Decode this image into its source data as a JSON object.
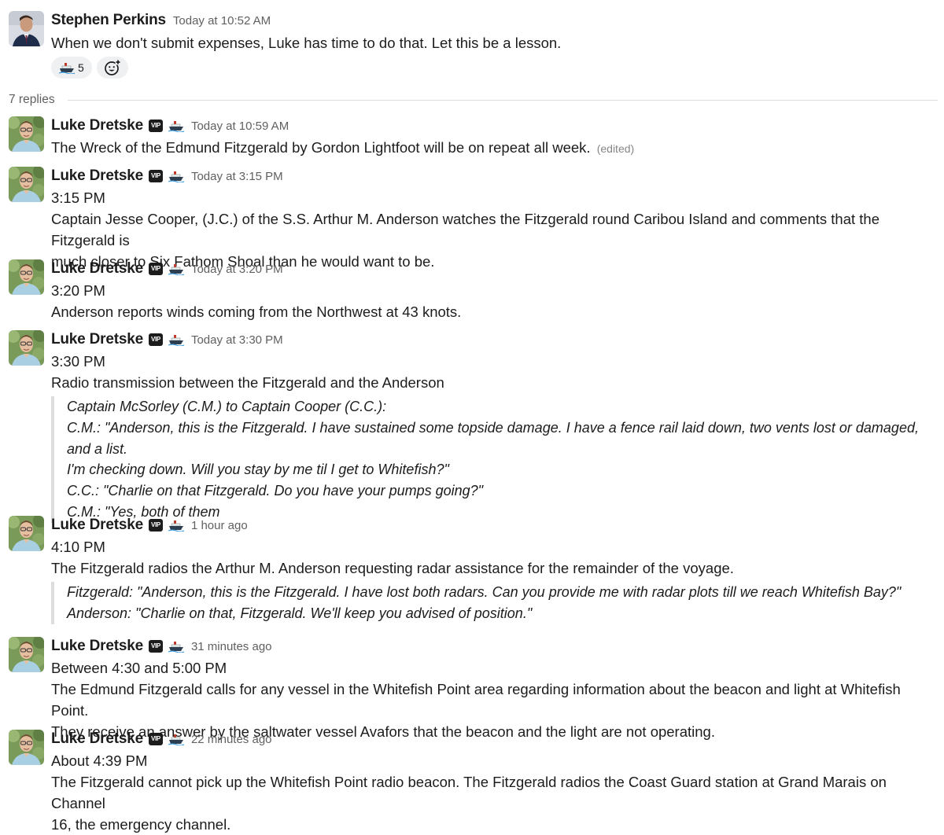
{
  "parent": {
    "author": "Stephen Perkins",
    "time": "Today at 10:52 AM",
    "text": "When we don't submit expenses, Luke has time to do that. Let this be a lesson.",
    "reaction": {
      "icon": "ship-emoji-icon",
      "count": "5"
    },
    "add_reaction_icon": "add-reaction-icon"
  },
  "thread": {
    "replies_label": "7 replies",
    "vip_label": "VIP",
    "edited_label": "(edited)",
    "replies": [
      {
        "author": "Luke Dretske",
        "time": "Today at 10:59 AM",
        "text": "The Wreck of the Edmund Fitzgerald by Gordon Lightfoot will be on repeat all week.",
        "edited": true
      },
      {
        "author": "Luke Dretske",
        "time": "Today at 3:15 PM",
        "lines": [
          "3:15 PM",
          "Captain Jesse Cooper, (J.C.) of the S.S. Arthur M. Anderson watches the Fitzgerald round Caribou Island and comments that the Fitzgerald is",
          "much closer to Six Fathom Shoal than he would want to be."
        ]
      },
      {
        "author": "Luke Dretske",
        "time": "Today at 3:20 PM",
        "lines": [
          "3:20 PM",
          "Anderson reports winds coming from the Northwest at 43 knots."
        ]
      },
      {
        "author": "Luke Dretske",
        "time": "Today at 3:30 PM",
        "lines": [
          "3:30 PM",
          "Radio transmission between the Fitzgerald and the Anderson"
        ],
        "quote": [
          "Captain McSorley (C.M.) to Captain Cooper (C.C.):",
          "C.M.: \"Anderson, this is the Fitzgerald. I have sustained some topside damage. I have a fence rail laid down, two vents lost or damaged, and a list.",
          "I'm checking down. Will you stay by me til I get to Whitefish?\"",
          "C.C.: \"Charlie on that Fitzgerald. Do you have your pumps going?\"",
          "C.M.: \"Yes, both of them"
        ]
      },
      {
        "author": "Luke Dretske",
        "time": "1 hour ago",
        "lines": [
          "4:10 PM",
          "The Fitzgerald radios the Arthur M. Anderson requesting radar assistance for the remainder of the voyage."
        ],
        "quote": [
          "Fitzgerald: \"Anderson, this is the Fitzgerald. I have lost both radars. Can you provide me with radar plots till we reach Whitefish Bay?\"",
          "Anderson: \"Charlie on that, Fitzgerald. We'll keep you advised of position.\""
        ]
      },
      {
        "author": "Luke Dretske",
        "time": "31 minutes ago",
        "lines": [
          "Between 4:30 and 5:00 PM",
          "The Edmund Fitzgerald calls for any vessel in the Whitefish Point area regarding information about the beacon and light at Whitefish Point.",
          "They receive an answer by the saltwater vessel Avafors that the beacon and the light are not operating."
        ]
      },
      {
        "author": "Luke Dretske",
        "time": "22 minutes ago",
        "lines": [
          "About 4:39 PM",
          "The Fitzgerald cannot pick up the Whitefish Point radio beacon. The Fitzgerald radios the Coast Guard station at Grand Marais on Channel",
          "16, the emergency channel."
        ]
      }
    ]
  }
}
